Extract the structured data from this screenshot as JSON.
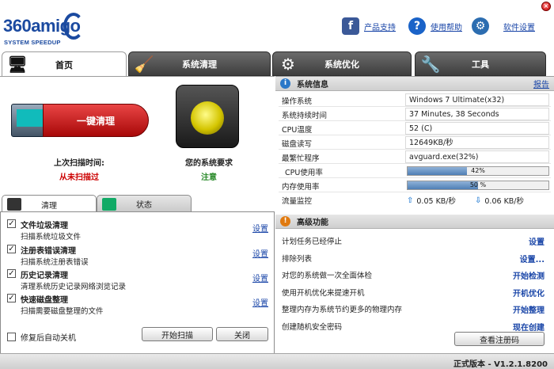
{
  "app": {
    "logo_main": "360amigo",
    "logo_sub": "SYSTEM SPEEDUP",
    "toplinks": [
      {
        "label": "产品支持"
      },
      {
        "label": "使用帮助"
      },
      {
        "label": "软件设置"
      }
    ]
  },
  "tabs": [
    {
      "label": "首页"
    },
    {
      "label": "系统清理"
    },
    {
      "label": "系统优化"
    },
    {
      "label": "工具"
    }
  ],
  "left": {
    "oneclick_label": "一键清理",
    "last_scan_label": "上次扫描时间:",
    "last_scan_value": "从未扫描过",
    "sys_req_label": "您的系统要求",
    "sys_req_value": "注意",
    "subtabs": [
      {
        "label": "清理"
      },
      {
        "label": "状态"
      }
    ],
    "items": [
      {
        "title": "文件垃圾清理",
        "desc": "扫描系统垃圾文件",
        "settings": "设置"
      },
      {
        "title": "注册表错误清理",
        "desc": "扫描系统注册表错误",
        "settings": "设置"
      },
      {
        "title": "历史记录清理",
        "desc": "清理系统历史记录网络浏览记录",
        "settings": "设置"
      },
      {
        "title": "快速磁盘整理",
        "desc": "扫描需要磁盘整理的文件",
        "settings": "设置"
      }
    ],
    "auto_shutdown": "修复后自动关机",
    "start_scan": "开始扫描",
    "close": "关闭"
  },
  "sysinfo": {
    "title": "系统信息",
    "report": "报告",
    "rows": [
      {
        "k": "操作系统",
        "v": "Windows 7 Ultimate(x32)"
      },
      {
        "k": "系统持续时间",
        "v": "37 Minutes, 38 Seconds"
      },
      {
        "k": "CPU温度",
        "v": "52 (C)"
      },
      {
        "k": "磁盘读写",
        "v": "12649KB/秒"
      },
      {
        "k": "最繁忙程序",
        "v": "avguard.exe(32%)"
      }
    ],
    "cpu_label": "CPU使用率",
    "cpu_pct": 42,
    "cpu_text": "42%",
    "mem_label": "内存使用率",
    "mem_pct": 50,
    "mem_text": "50 %",
    "net_label": "流量监控",
    "net_up": "0.05 KB/秒",
    "net_down": "0.06 KB/秒"
  },
  "advanced": {
    "title": "高级功能",
    "rows": [
      {
        "k": "计划任务已经停止",
        "a": "设置"
      },
      {
        "k": "排除列表",
        "a": "设置..."
      },
      {
        "k": "对您的系统做一次全面体检",
        "a": "开始检测"
      },
      {
        "k": "使用开机优化来提速开机",
        "a": "开机优化"
      },
      {
        "k": "整理内存为系统节约更多的物理内存",
        "a": "开始整理"
      },
      {
        "k": "创建随机安全密码",
        "a": "现在创建"
      }
    ],
    "view_reg": "查看注册码"
  },
  "footer": {
    "version": "正式版本 - V1.2.1.8200"
  },
  "colors": {
    "link": "#1a46a8",
    "danger": "#cc0000",
    "ok": "#2a8a2a"
  }
}
